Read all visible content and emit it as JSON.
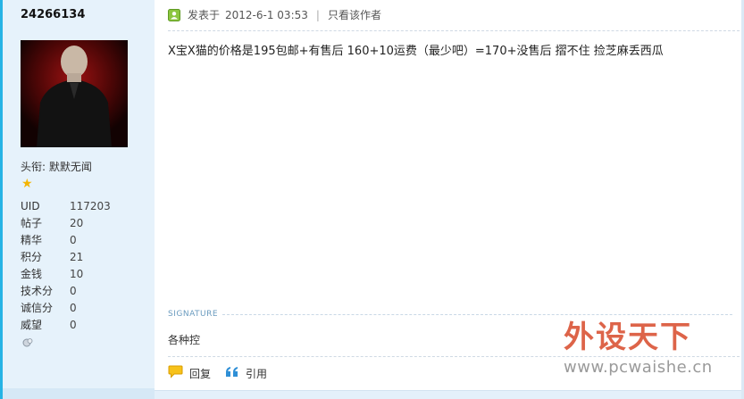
{
  "user": {
    "username": "24266134",
    "title_label": "头衔:",
    "title_value": "默默无闻",
    "stats": [
      {
        "key": "UID",
        "value": "117203"
      },
      {
        "key": "帖子",
        "value": "20"
      },
      {
        "key": "精华",
        "value": "0"
      },
      {
        "key": "积分",
        "value": "21"
      },
      {
        "key": "金钱",
        "value": "10"
      },
      {
        "key": "技术分",
        "value": "0"
      },
      {
        "key": "诚信分",
        "value": "0"
      },
      {
        "key": "威望",
        "value": "0"
      }
    ]
  },
  "post": {
    "posted_label": "发表于",
    "posted_time": "2012-6-1 03:53",
    "separator": "|",
    "author_only": "只看该作者",
    "content": "X宝X猫的价格是195包邮+有售后  160+10运费（最少吧）=170+没售后  摺不住  捡芝麻丢西瓜",
    "signature_label": "SIGNATURE",
    "signature_text": "各种控"
  },
  "actions": {
    "reply": "回复",
    "quote": "引用"
  },
  "watermark": {
    "title": "外设天下",
    "url": "www.pcwaishe.cn"
  },
  "colors": {
    "accent": "#26b3e5",
    "sidebar_bg": "#e6f2fb",
    "star": "#f4b400"
  }
}
